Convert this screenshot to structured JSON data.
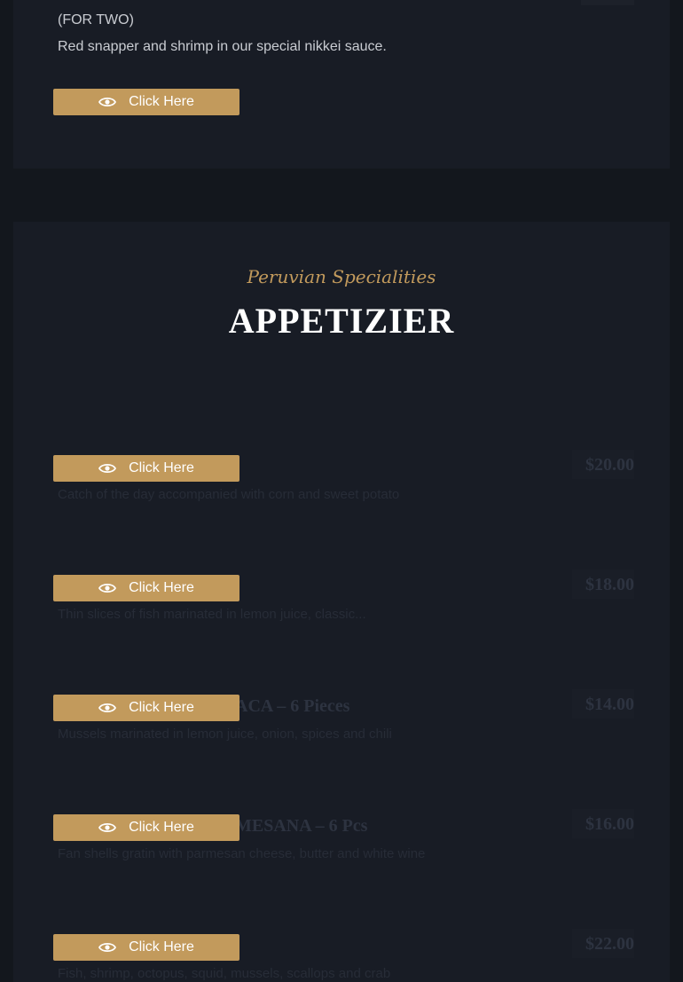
{
  "top_item": {
    "subtitle": "(FOR TWO)",
    "description": "Red snapper and shrimp in our special nikkei sauce.",
    "button_label": "Click Here"
  },
  "section": {
    "kicker": "Peruvian Specialities",
    "heading": "APPETIZIER"
  },
  "items": [
    {
      "name": "",
      "price": "$20.00",
      "description": "Catch of the day accompanied with corn and sweet potato",
      "button_label": "Click Here"
    },
    {
      "name": "",
      "price": "$18.00",
      "description": "Thin slices of fish marinated in lemon juice, classic...",
      "button_label": "Click Here"
    },
    {
      "name": "ACA – 6 Pieces",
      "price": "$14.00",
      "description": "Mussels marinated in lemon juice, onion, spices and chili",
      "button_label": "Click Here"
    },
    {
      "name": "MESANA – 6 Pcs",
      "price": "$16.00",
      "description": "Fan shells gratin with parmesan cheese, butter and white wine",
      "button_label": "Click Here"
    },
    {
      "name": "",
      "price": "$22.00",
      "description": "Fish, shrimp, octopus, squid, mussels, scallops and crab",
      "button_label": "Click Here"
    }
  ]
}
